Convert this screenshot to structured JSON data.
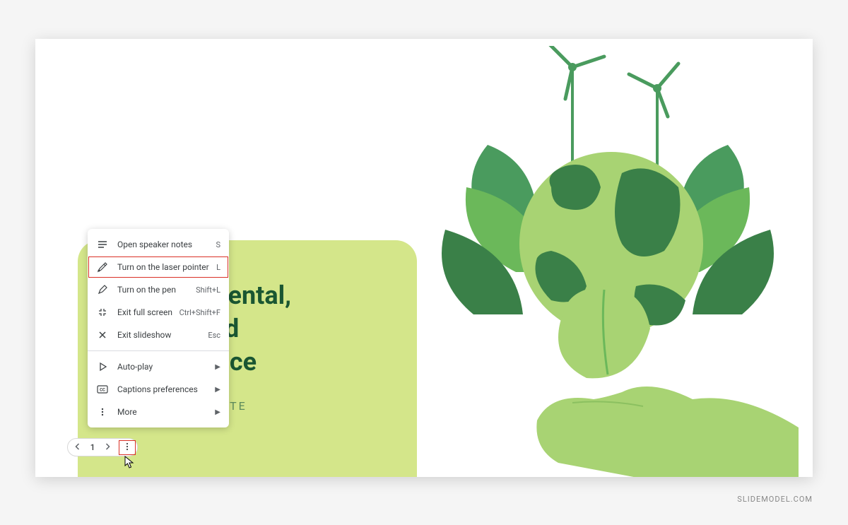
{
  "slide": {
    "title_line1": "Environmental,",
    "title_line2": "Social and",
    "title_line3": "Governance",
    "subtitle": "SLIDES TEMPLATE"
  },
  "menu": {
    "items": [
      {
        "label": "Open speaker notes",
        "shortcut": "S",
        "icon": "notes"
      },
      {
        "label": "Turn on the laser pointer",
        "shortcut": "L",
        "icon": "laser",
        "highlighted": true
      },
      {
        "label": "Turn on the pen",
        "shortcut": "Shift+L",
        "icon": "pen"
      },
      {
        "label": "Exit full screen",
        "shortcut": "Ctrl+Shift+F",
        "icon": "exitfs"
      },
      {
        "label": "Exit slideshow",
        "shortcut": "Esc",
        "icon": "close"
      }
    ],
    "subitems": [
      {
        "label": "Auto-play",
        "icon": "play",
        "arrow": true
      },
      {
        "label": "Captions preferences",
        "icon": "cc",
        "arrow": true
      },
      {
        "label": "More",
        "icon": "more",
        "arrow": true
      }
    ]
  },
  "nav": {
    "page": "1"
  },
  "watermark": "SLIDEMODEL.COM"
}
